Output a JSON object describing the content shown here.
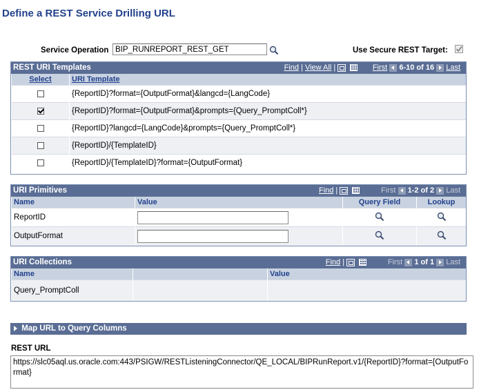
{
  "page": {
    "title": "Define a REST Service Drilling URL"
  },
  "service_operation": {
    "label": "Service Operation",
    "value": "BIP_RUNREPORT_REST_GET"
  },
  "secure_target": {
    "label": "Use Secure REST Target:",
    "checked": true
  },
  "templates_grid": {
    "title": "REST URI Templates",
    "find": "Find",
    "view_all": "View All",
    "first": "First",
    "range": "6-10 of 16",
    "last": "Last",
    "col_select": "Select",
    "col_template": "URI Template",
    "rows": [
      {
        "checked": false,
        "template": "{ReportID}?format={OutputFormat}&langcd={LangCode}"
      },
      {
        "checked": true,
        "template": "{ReportID}?format={OutputFormat}&prompts={Query_PromptColl*}"
      },
      {
        "checked": false,
        "template": "{ReportID}?langcd={LangCode}&prompts={Query_PromptColl*}"
      },
      {
        "checked": false,
        "template": "{ReportID}/{TemplateID}"
      },
      {
        "checked": false,
        "template": "{ReportID}/{TemplateID}?format={OutputFormat}"
      }
    ]
  },
  "primitives_grid": {
    "title": "URI Primitives",
    "find": "Find",
    "first": "First",
    "range": "1-2 of 2",
    "last": "Last",
    "col_name": "Name",
    "col_value": "Value",
    "col_query": "Query Field",
    "col_lookup": "Lookup",
    "rows": [
      {
        "name": "ReportID",
        "value": ""
      },
      {
        "name": "OutputFormat",
        "value": ""
      }
    ]
  },
  "collections_grid": {
    "title": "URI Collections",
    "find": "Find",
    "first": "First",
    "range": "1 of 1",
    "last": "Last",
    "col_name": "Name",
    "col_value": "Value",
    "rows": [
      {
        "name": "Query_PromptColl",
        "value": ""
      }
    ]
  },
  "map_section": {
    "title": "Map URL to Query Columns"
  },
  "rest_url": {
    "label": "REST URL",
    "value": "https://slc05aql.us.oracle.com:443/PSIGW/RESTListeningConnector/QE_LOCAL/BIPRunReport.v1/{ReportID}?format={OutputFormat}"
  }
}
